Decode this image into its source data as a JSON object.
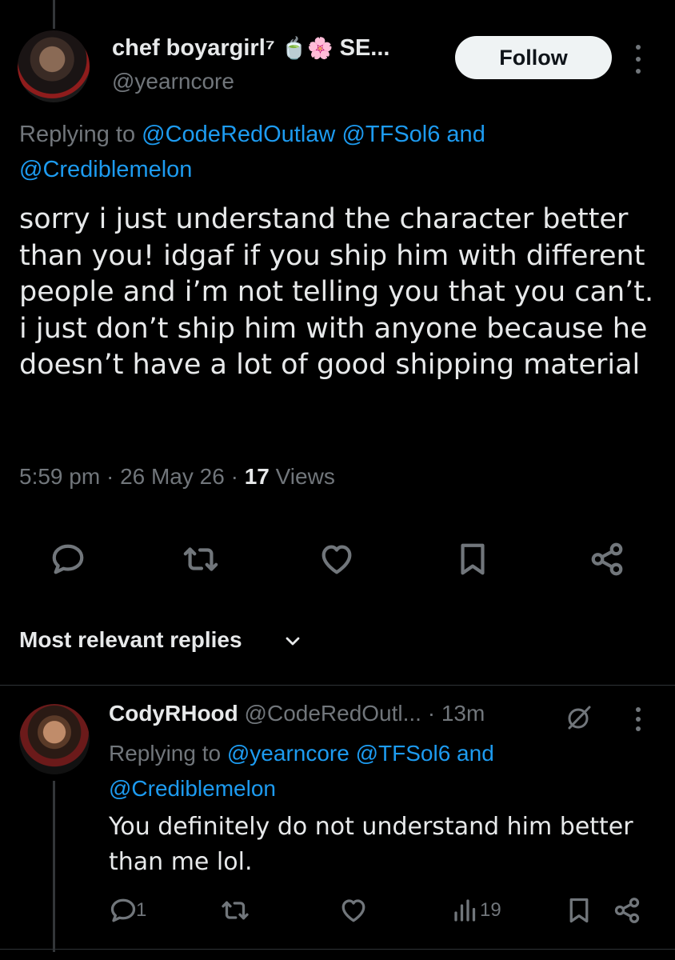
{
  "main_tweet": {
    "display_name": "chef boyargirl⁷ ",
    "name_emojis": "🍵🌸",
    "name_suffix": " SE...",
    "handle": "@yearncore",
    "follow_label": "Follow",
    "replying_prefix": "Replying to ",
    "replying_mentions": [
      "@CodeRedOutlaw",
      "@TFSol6",
      "@Crediblemelon"
    ],
    "replying_and": " and",
    "text": "sorry i just understand the character better than you! idgaf if you ship him with different people and i’m not telling you that you can’t. i just don’t ship him with anyone because he doesn’t have a lot of good shipping material",
    "time": "5:59 pm",
    "date": "26 May 26",
    "views_count": "17",
    "views_label": " Views",
    "separator": " · ",
    "actions": [
      "reply-icon",
      "retweet-icon",
      "like-icon",
      "bookmark-icon",
      "share-icon"
    ]
  },
  "replies_section": {
    "title": "Most relevant replies"
  },
  "reply": {
    "display_name": "CodyRHood",
    "handle": " @CodeRedOutl...",
    "age": " · 13m",
    "replying_prefix": "Replying to ",
    "replying_mentions": [
      "@yearncore",
      "@TFSol6",
      "@Crediblemelon"
    ],
    "replying_and": " and",
    "text": "You definitely do not understand him better than me lol.",
    "reply_count": "1",
    "views_count": "19"
  },
  "colors": {
    "background": "#000000",
    "text": "#e7e9ea",
    "muted": "#71767b",
    "link": "#1d9bf0",
    "follow_bg": "#eff3f4"
  }
}
